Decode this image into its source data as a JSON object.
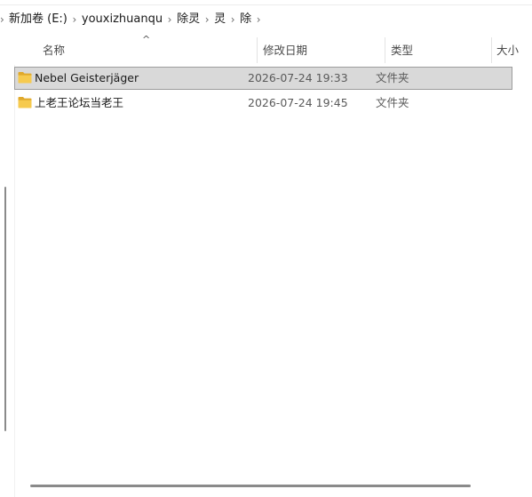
{
  "breadcrumb": {
    "items": [
      {
        "label": "新加卷 (E:)"
      },
      {
        "label": "youxizhuanqu"
      },
      {
        "label": "除灵"
      },
      {
        "label": "灵"
      },
      {
        "label": "除"
      }
    ],
    "separator": "›"
  },
  "columns": {
    "name": "名称",
    "date_modified": "修改日期",
    "type": "类型",
    "size": "大小",
    "sort_indicator": "^"
  },
  "files": [
    {
      "icon": "folder-icon",
      "name": "Nebel Geisterjäger",
      "date_modified": "2026-07-24 19:33",
      "type": "文件夹",
      "selected": true
    },
    {
      "icon": "folder-icon",
      "name": "上老王论坛当老王",
      "date_modified": "2026-07-24 19:45",
      "type": "文件夹",
      "selected": false
    }
  ],
  "colors": {
    "selection_bg": "#d9d9d9",
    "folder_yellow": "#f4c542",
    "folder_dark": "#e0a92b"
  }
}
